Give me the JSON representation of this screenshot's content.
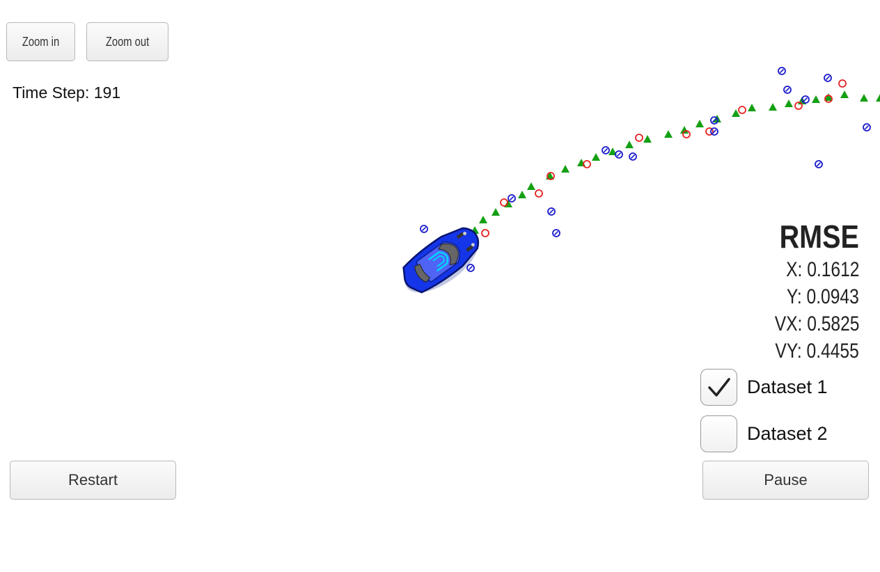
{
  "toolbar": {
    "zoom_in_label": "Zoom in",
    "zoom_out_label": "Zoom out"
  },
  "status": {
    "time_step": "Time Step: 191"
  },
  "rmse": {
    "title": "RMSE",
    "x": "X: 0.1612",
    "y": "Y: 0.0943",
    "vx": "VX: 0.5825",
    "vy": "VY: 0.4455"
  },
  "datasets": [
    {
      "label": "Dataset 1",
      "checked": true
    },
    {
      "label": "Dataset 2",
      "checked": false
    }
  ],
  "controls": {
    "restart_label": "Restart",
    "pause_label": "Pause"
  },
  "legend_colors": {
    "ground_truth": "#14a014",
    "lidar": "#e82020",
    "radar": "#1a1acc",
    "car": "#1333e6"
  },
  "icons": {
    "ground_truth_marker": "green-triangle-icon",
    "lidar_marker": "red-circle-icon",
    "radar_marker": "blue-circle-arrow-icon",
    "vehicle": "car-icon",
    "checkmark": "checkmark-icon"
  }
}
